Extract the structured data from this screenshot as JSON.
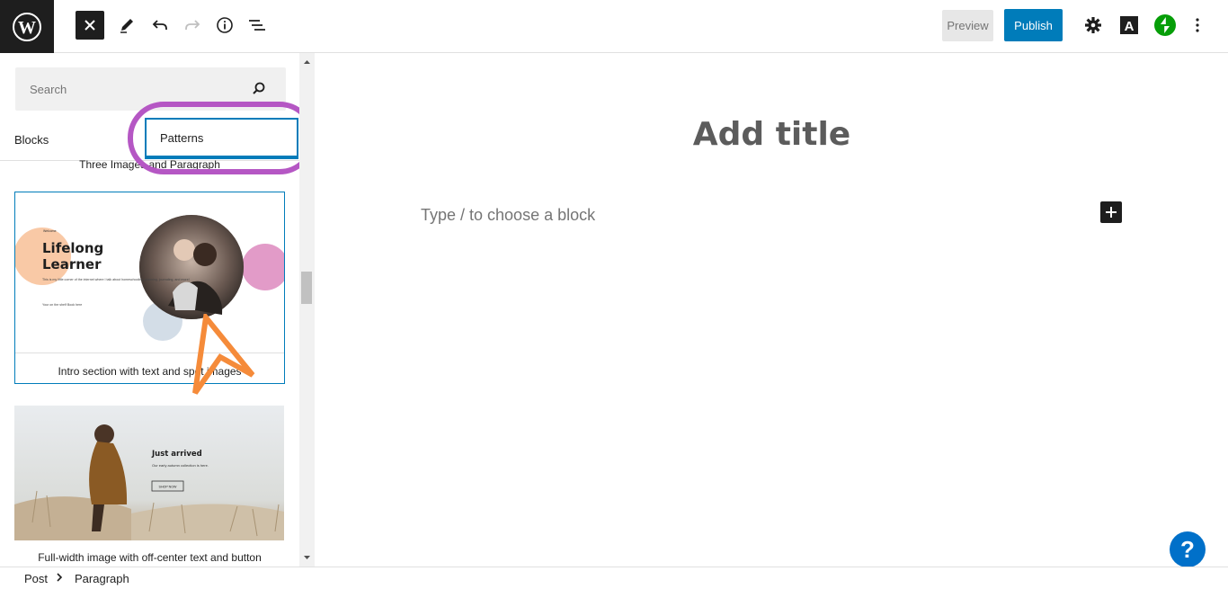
{
  "toolbar": {
    "preview_label": "Preview",
    "publish_label": "Publish"
  },
  "inserter": {
    "search_placeholder": "Search",
    "tabs": [
      {
        "label": "Blocks"
      },
      {
        "label": "Patterns"
      }
    ],
    "previous_pattern_label": "Three Images and Paragraph",
    "patterns": [
      {
        "label": "Intro section with text and spot images",
        "preview": {
          "kicker": "Welcome",
          "heading_line1": "Lifelong",
          "heading_line2": "Learner",
          "body": "This is my little corner of the internet where I talk about homeschooling, planning, journaling, and more!",
          "link": "Your on the shelf Book here"
        }
      },
      {
        "label": "Full-width image with off-center text and button",
        "preview": {
          "heading": "Just arrived",
          "body": "Our early autumn collection is here.",
          "button": "SHOP NOW"
        }
      }
    ]
  },
  "editor": {
    "title_placeholder": "Add title",
    "block_placeholder": "Type / to choose a block",
    "help_label": "?"
  },
  "breadcrumb": {
    "items": [
      "Post",
      "Paragraph"
    ]
  },
  "colors": {
    "accent": "#007cba",
    "highlight_ring": "#b557c4",
    "annotation_arrow": "#f58b3a",
    "jetpack": "#069e08"
  }
}
